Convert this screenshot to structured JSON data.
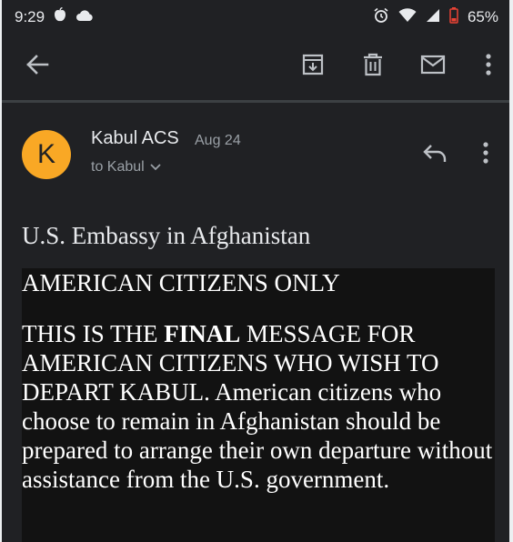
{
  "status_bar": {
    "time": "9:29",
    "battery_percent": "65%",
    "left_icons": [
      "apple-icon",
      "cloud-icon"
    ],
    "right_icons": [
      "alarm-icon",
      "wifi-icon",
      "signal-icon",
      "battery-icon"
    ]
  },
  "toolbar": {
    "icons": [
      "back-arrow-icon",
      "archive-icon",
      "delete-icon",
      "mark-unread-icon",
      "more-vert-icon"
    ]
  },
  "email": {
    "avatar_letter": "K",
    "avatar_color": "#f9a825",
    "sender": "Kabul ACS",
    "date": "Aug 24",
    "recipient": "to Kabul",
    "heading": "U.S. Embassy in Afghanistan",
    "line1": "AMERICAN CITIZENS ONLY",
    "para_start": "THIS IS THE ",
    "para_bold": "FINAL",
    "para_rest": " MESSAGE FOR AMERICAN CITIZENS WHO WISH TO DEPART KABUL.  American citizens who choose to remain in Afghanistan should be prepared to arrange their own departure without assistance from the U.S. government."
  },
  "colors": {
    "background": "#202124",
    "message_background": "#121212",
    "battery_warning": "#ea4335"
  }
}
